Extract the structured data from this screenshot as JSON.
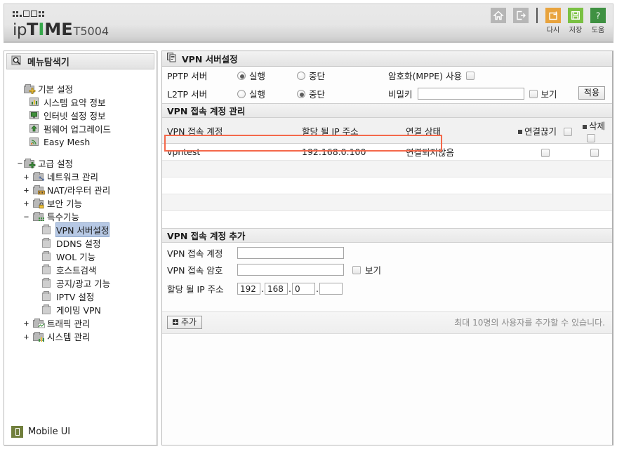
{
  "header": {
    "logo_prefix": "ip",
    "logo_main_1": "T",
    "logo_main_i": "I",
    "logo_main_2": "ME",
    "model": "T5004"
  },
  "toolbar": {
    "items": [
      {
        "icon": "home-icon",
        "caption": ""
      },
      {
        "icon": "logout-icon",
        "caption": ""
      },
      {
        "icon": "restart-icon",
        "caption": "다시"
      },
      {
        "icon": "save-icon",
        "caption": "저장"
      },
      {
        "icon": "help-icon",
        "caption": "도움"
      }
    ]
  },
  "sidebar": {
    "title": "메뉴탐색기",
    "footer_label": "Mobile UI",
    "groups": [
      {
        "label": "기본 설정",
        "expander": "",
        "icon": "folder-plus-icon",
        "children": [
          {
            "label": "시스템 요약 정보",
            "icon": "chart-icon"
          },
          {
            "label": "인터넷 설정 정보",
            "icon": "monitor-icon"
          },
          {
            "label": "펌웨어 업그레이드",
            "icon": "upload-icon"
          },
          {
            "label": "Easy Mesh",
            "icon": "signal-icon"
          }
        ]
      },
      {
        "label": "고급 설정",
        "expander": "−",
        "icon": "folder-plus-icon",
        "children": [
          {
            "label": "네트워크 관리",
            "icon": "network-icon",
            "expander": "+"
          },
          {
            "label": "NAT/라우터 관리",
            "icon": "router-icon",
            "expander": "+"
          },
          {
            "label": "보안 기능",
            "icon": "lock-icon",
            "expander": "+"
          },
          {
            "label": "특수기능",
            "icon": "grid-icon",
            "expander": "−"
          }
        ]
      }
    ],
    "special_items": [
      {
        "label": "VPN 서버설정",
        "selected": true
      },
      {
        "label": "DDNS 설정",
        "selected": false
      },
      {
        "label": "WOL 기능",
        "selected": false
      },
      {
        "label": "호스트검색",
        "selected": false
      },
      {
        "label": "공지/광고 기능",
        "selected": false
      },
      {
        "label": "IPTV 설정",
        "selected": false
      },
      {
        "label": "게이밍 VPN",
        "selected": false
      }
    ],
    "tail_items": [
      {
        "label": "트래픽 관리",
        "icon": "traffic-icon",
        "expander": "+"
      },
      {
        "label": "시스템 관리",
        "icon": "sysmgr-icon",
        "expander": "+"
      }
    ]
  },
  "main": {
    "panel_title": "VPN 서버설정",
    "server_settings": {
      "rows": [
        {
          "label": "PPTP 서버",
          "run_label": "실행",
          "stop_label": "중단",
          "selected": "run"
        },
        {
          "label": "L2TP 서버",
          "run_label": "실행",
          "stop_label": "중단",
          "selected": "stop"
        }
      ],
      "mppe_label": "암호화(MPPE) 사용",
      "mppe_checked": false,
      "secret_label": "비밀키",
      "secret_value": "",
      "secret_show_label": "보기",
      "secret_show_checked": false,
      "apply_label": "적용"
    },
    "account_mgmt": {
      "section_title": "VPN 접속 계정 관리",
      "columns": [
        "VPN 접속 계정",
        "할당 될 IP 주소",
        "연결 상태",
        "연결끊기",
        "삭제"
      ],
      "rows": [
        {
          "account": "vpntest",
          "ip": "192.168.0.100",
          "status": "연결되지않음",
          "disconnect_checked": false,
          "delete_checked": false,
          "highlighted": true
        }
      ],
      "empty_row_count": 4
    },
    "account_add": {
      "section_title": "VPN 접속 계정 추가",
      "account_label": "VPN 접속 계정",
      "account_value": "",
      "password_label": "VPN 접속 암호",
      "password_value": "",
      "password_show_label": "보기",
      "password_show_checked": false,
      "ip_label": "할당 될 IP 주소",
      "ip_octets": [
        "192",
        "168",
        "0",
        ""
      ],
      "add_button_label": "추가",
      "note": "최대 10명의 사용자를 추가할 수 있습니다."
    }
  },
  "colors": {
    "accent_green": "#36a84b",
    "highlight_red": "#f4684a",
    "selection_blue": "#b6c8e4",
    "mobile_olive": "#717f3d"
  }
}
